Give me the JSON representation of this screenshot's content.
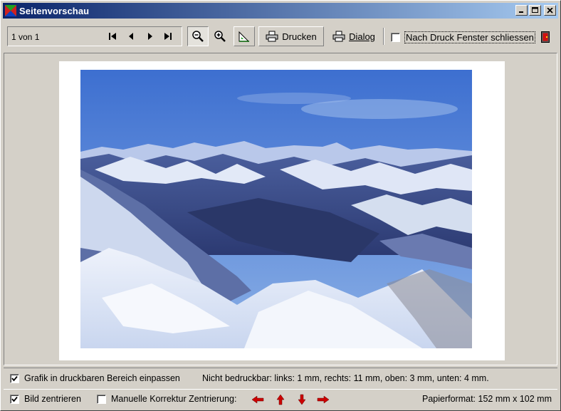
{
  "window": {
    "title": "Seitenvorschau"
  },
  "title_buttons": {
    "minimize": "_",
    "maximize": "□",
    "close": "✕"
  },
  "pager": {
    "label": "1 von 1"
  },
  "toolbar": {
    "print_label": "Drucken",
    "dialog_label": "Dialog",
    "close_after_print_label": "Nach Druck Fenster schliessen",
    "close_after_print_checked": false
  },
  "options": {
    "fit_label": "Grafik in druckbaren Bereich einpassen",
    "fit_checked": true,
    "center_label": "Bild zentrieren",
    "center_checked": true,
    "manual_label": "Manuelle Korrektur Zentrierung:",
    "manual_checked": false
  },
  "info": {
    "unprintable": "Nicht bedruckbar: links: 1 mm, rechts: 11 mm, oben: 3 mm, unten: 4 mm.",
    "paper_format": "Papierformat: 152 mm x 102 mm"
  },
  "colors": {
    "titlebar_start": "#0a246a",
    "titlebar_end": "#a6caf0",
    "arrow": "#cc0000"
  }
}
